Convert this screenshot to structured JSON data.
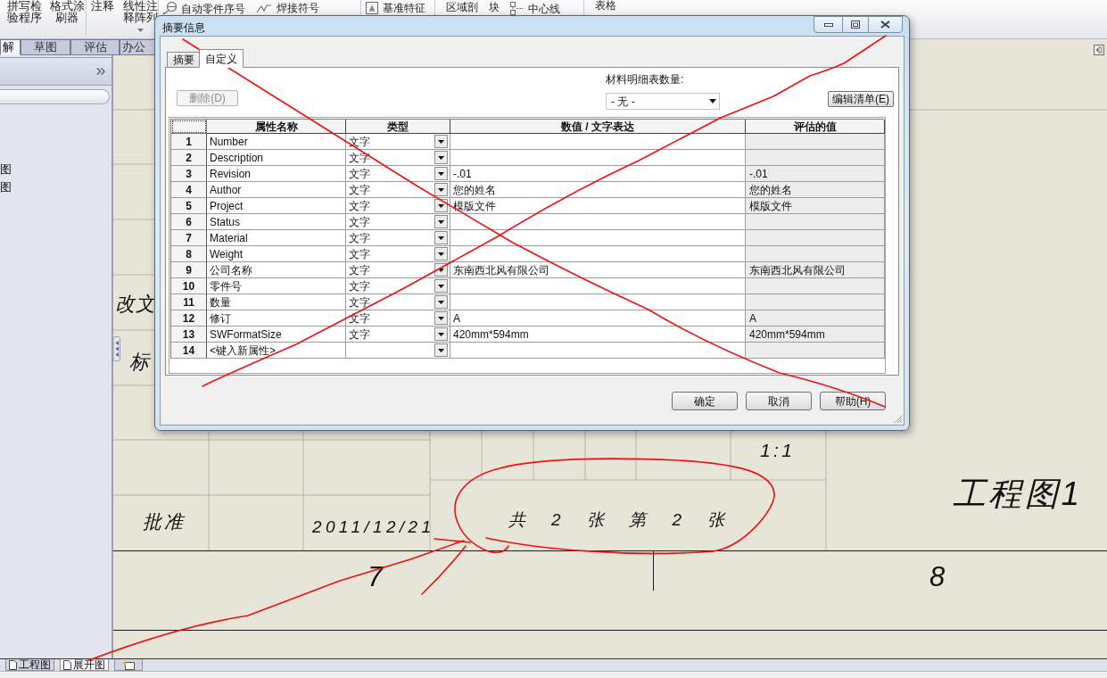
{
  "ribbon": {
    "groups": [
      {
        "tools": [
          {
            "label": "拼写检验程序",
            "kind": "stacked"
          },
          {
            "label": "格式涂刷器",
            "kind": "stacked"
          }
        ]
      },
      {
        "tools": [
          {
            "label": "注释",
            "kind": "stacked"
          },
          {
            "label": "线性注释阵列",
            "kind": "menu"
          }
        ]
      },
      {
        "tools": [
          {
            "label": "自动零件序号",
            "kind": "balloon"
          },
          {
            "label": "焊接符号",
            "kind": "weld"
          }
        ]
      },
      {
        "tools": [
          {
            "label": "基准特征",
            "kind": "datum"
          }
        ]
      },
      {
        "tools": [
          {
            "label": "区域剖",
            "kind": "plain"
          },
          {
            "label": "块",
            "kind": "plain"
          },
          {
            "label": "中心线",
            "kind": "centerline"
          }
        ]
      },
      {
        "tools": [
          {
            "label": "表格",
            "kind": "plain"
          }
        ]
      }
    ]
  },
  "command_tabs": [
    {
      "label": "解",
      "selected": true
    },
    {
      "label": "草图",
      "selected": false
    },
    {
      "label": "评估",
      "selected": false
    },
    {
      "label": "办公",
      "selected": false
    }
  ],
  "feature_panel": {
    "tree_items": [
      "图",
      "图"
    ]
  },
  "sheet": {
    "side_labels": [
      "改文",
      "标"
    ],
    "title_block": {
      "scale": "1:1",
      "drawing_name": "工程图1",
      "approval_label": "批准",
      "date": "2011/12/21",
      "sheet_count": "共 2 张 第 2 张",
      "zone_numbers": [
        "7",
        "8"
      ]
    }
  },
  "sheet_tabs": [
    {
      "label": "工程图",
      "selected": false
    },
    {
      "label": "展开图",
      "selected": true
    }
  ],
  "dialog": {
    "title": "摘要信息",
    "tabs": [
      {
        "label": "摘要",
        "selected": false
      },
      {
        "label": "自定义",
        "selected": true
      }
    ],
    "delete_button": {
      "label": "删除(D)",
      "disabled": true
    },
    "bom_quantity": {
      "label": "材料明细表数量:",
      "value": "- 无 -"
    },
    "edit_list_button": "编辑清单(E)",
    "table": {
      "columns": [
        "属性名称",
        "类型",
        "数值 / 文字表达",
        "评估的值"
      ],
      "rows": [
        {
          "number": "1",
          "name": "Number",
          "type": "文字"
        },
        {
          "number": "2",
          "name": "Description",
          "type": "文字"
        },
        {
          "number": "3",
          "name": "Revision",
          "type": "文字",
          "value": "-.01",
          "evaluated_value": "-.01"
        },
        {
          "number": "4",
          "name": "Author",
          "type": "文字",
          "value": "您的姓名",
          "evaluated_value": "您的姓名"
        },
        {
          "number": "5",
          "name": "Project",
          "type": "文字",
          "value": "模版文件",
          "evaluated_value": "模版文件"
        },
        {
          "number": "6",
          "name": "Status",
          "type": "文字"
        },
        {
          "number": "7",
          "name": "Material",
          "type": "文字"
        },
        {
          "number": "8",
          "name": "Weight",
          "type": "文字"
        },
        {
          "number": "9",
          "name": "公司名称",
          "type": "文字",
          "value": "东南西北风有限公司",
          "evaluated_value": "东南西北风有限公司"
        },
        {
          "number": "10",
          "name": "零件号",
          "type": "文字"
        },
        {
          "number": "11",
          "name": "数量",
          "type": "文字"
        },
        {
          "number": "12",
          "name": "修订",
          "type": "文字",
          "value": "A",
          "evaluated_value": "A"
        },
        {
          "number": "13",
          "name": "SWFormatSize",
          "type": "文字",
          "value": "420mm*594mm",
          "evaluated_value": "420mm*594mm"
        },
        {
          "number": "14",
          "name": "<键入新属性>"
        }
      ]
    },
    "buttons": [
      "确定",
      "取消",
      "帮助(H)"
    ]
  }
}
